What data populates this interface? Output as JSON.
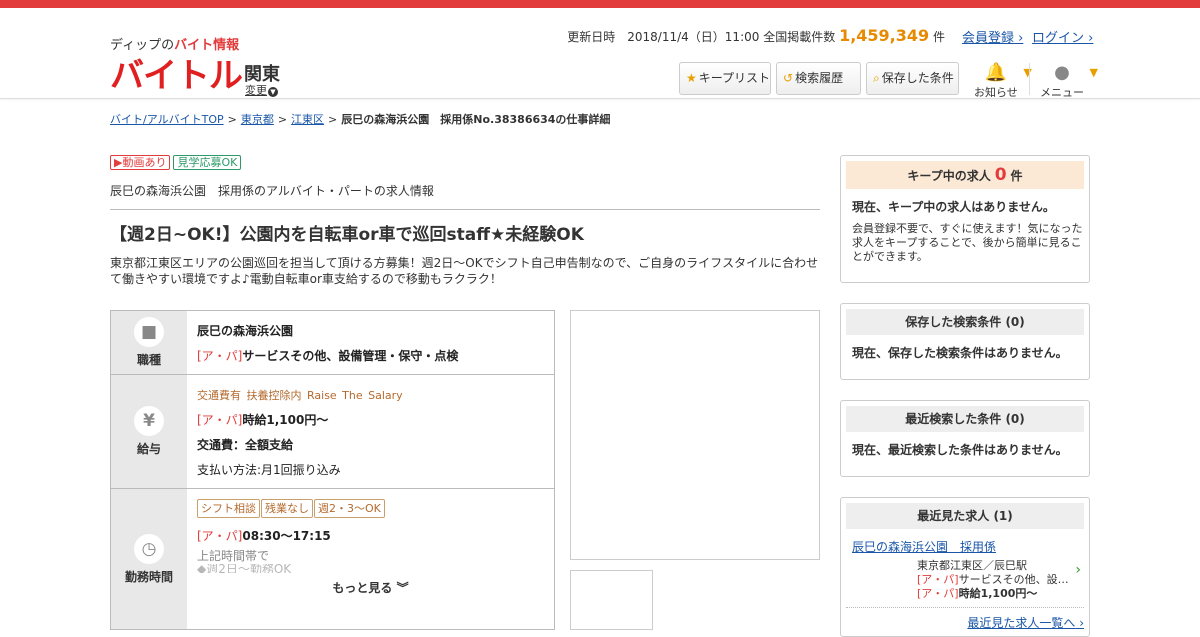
{
  "header": {
    "tagline_prefix": "ディップの",
    "tagline_red": "バイト情報",
    "logo": "バイトル",
    "region": "関東",
    "region_change": "変更",
    "updated_label": "更新日時　2018/11/4（日）11:00",
    "listings_label": "全国掲載件数",
    "listings_count": "1,459,349",
    "listings_unit": "件",
    "register_link": "会員登録",
    "login_link": "ログイン",
    "keep_list_button": "キープリスト",
    "history_button": "検索履歴",
    "saved_conditions_button": "保存した条件",
    "notifications_label": "お知らせ",
    "menu_label": "メニュー"
  },
  "breadcrumb": {
    "top": "バイト/アルバイトTOP",
    "pref": "東京都",
    "ward": "江東区",
    "current": "辰巳の森海浜公園　採用係No.38386634の仕事詳細"
  },
  "job": {
    "tag_video": "動画あり",
    "tag_visit": "見学応募OK",
    "company_heading": "辰巳の森海浜公園　採用係のアルバイト・パートの求人情報",
    "title": "【週2日~OK!】公園内を自転車or車で巡回staff★未経験OK",
    "description": "東京都江東区エリアの公園巡回を担当して頂ける方募集！週2日～OKでシフト自己申告制なので、ご自身のライフスタイルに合わせて働きやすい環境ですよ♪電動自転車or車支給するので移動もラクラク！"
  },
  "table": {
    "type_label": "職種",
    "type_company": "辰巳の森海浜公園",
    "type_tag": "[ア・パ]",
    "type_value": "サービスその他、設備管理・保守・点検",
    "pay_label": "給与",
    "pay_benefits": "交通費有  扶養控除内  Raise The Salary",
    "pay_tag": "[ア・パ]",
    "pay_value": "時給1,100円～",
    "pay_transport": "交通費：全額支給",
    "pay_method": "支払い方法:月1回振り込み",
    "hours_label": "勤務時間",
    "hours_chips": [
      "シフト相談",
      "残業なし",
      "週2・3〜OK"
    ],
    "hours_tag": "[ア・パ]",
    "hours_value": "08:30～17:15",
    "hours_note1": "上記時間帯で",
    "hours_note2": "◆週2日～勤務OK",
    "more_label": "もっと見る"
  },
  "sidebar": {
    "keep_title": "キープ中の求人",
    "keep_count": "0",
    "keep_unit": "件",
    "keep_empty": "現在、キープ中の求人はありません。",
    "keep_note": "会員登録不要で、すぐに使えます！気になった求人をキープすることで、後から簡単に見ることができます。",
    "saved_title": "保存した検索条件",
    "saved_count": "(0)",
    "saved_empty": "現在、保存した検索条件はありません。",
    "recent_search_title": "最近検索した条件",
    "recent_search_count": "(0)",
    "recent_search_empty": "現在、最近検索した条件はありません。",
    "recent_view_title": "最近見た求人",
    "recent_view_count": "(1)",
    "recent_view_name": "辰巳の森海浜公園　採用係",
    "recent_view_place": "東京都江東区／辰巳駅",
    "recent_view_tag": "[ア・パ]",
    "recent_view_type": "サービスその他、設…",
    "recent_view_pay": "時給1,100円～",
    "recent_view_all": "最近見た求人一覧へ"
  },
  "colors": {
    "brand_red": "#e23c3c",
    "accent_orange": "#e88a00",
    "link": "#1a56a8"
  }
}
